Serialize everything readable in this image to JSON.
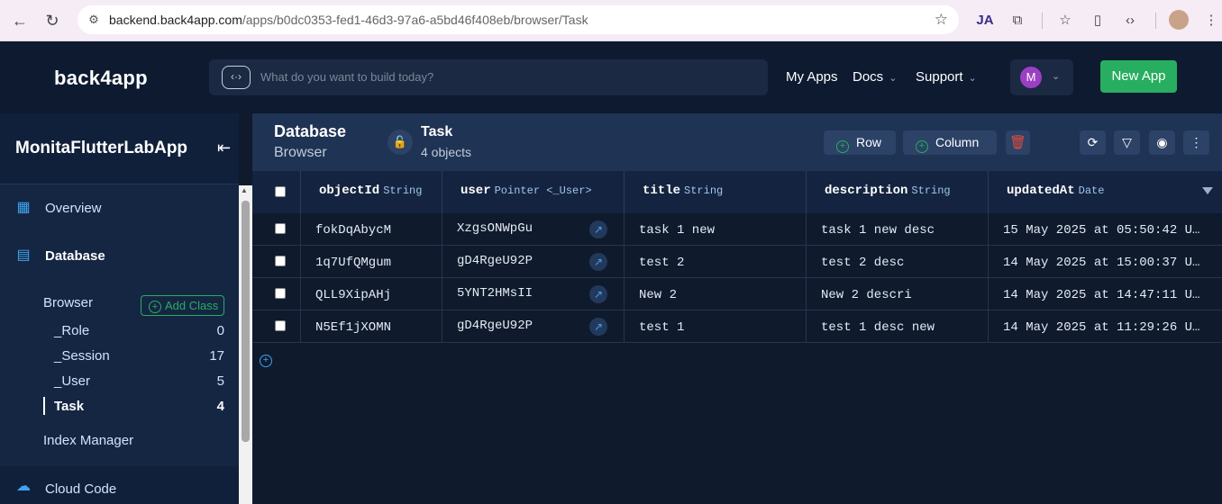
{
  "browser": {
    "url_host": "backend.back4app.com",
    "url_path": "/apps/b0dc0353-fed1-46d3-97a6-a5bd46f408eb/browser/Task"
  },
  "header": {
    "logo": "back4app",
    "search_placeholder": "What do you want to build today?",
    "nav": {
      "my_apps": "My Apps",
      "docs": "Docs",
      "support": "Support"
    },
    "avatar_initial": "M",
    "new_app": "New App"
  },
  "sidebar": {
    "app_name": "MonitaFlutterLabApp",
    "overview": "Overview",
    "database": "Database",
    "browser": "Browser",
    "add_class": "Add Class",
    "classes": [
      {
        "name": "_Role",
        "count": "0"
      },
      {
        "name": "_Session",
        "count": "17"
      },
      {
        "name": "_User",
        "count": "5"
      },
      {
        "name": "Task",
        "count": "4"
      }
    ],
    "index_manager": "Index Manager",
    "cloud_code": "Cloud Code"
  },
  "content_header": {
    "title": "Database",
    "subtitle": "Browser",
    "class_name": "Task",
    "object_count": "4 objects",
    "row_btn": "Row",
    "column_btn": "Column"
  },
  "table": {
    "columns": [
      {
        "name": "objectId",
        "type": "String"
      },
      {
        "name": "user",
        "type": "Pointer <_User>"
      },
      {
        "name": "title",
        "type": "String"
      },
      {
        "name": "description",
        "type": "String"
      },
      {
        "name": "updatedAt",
        "type": "Date"
      }
    ],
    "rows": [
      {
        "objectId": "fokDqAbycM",
        "user": "XzgsONWpGu",
        "title": "task 1 new",
        "description": "task 1 new desc",
        "updatedAt": "15 May 2025 at 05:50:42 U…"
      },
      {
        "objectId": "1q7UfQMgum",
        "user": "gD4RgeU92P",
        "title": "test 2",
        "description": "test 2 desc",
        "updatedAt": "14 May 2025 at 15:00:37 U…"
      },
      {
        "objectId": "QLL9XipAHj",
        "user": "5YNT2HMsII",
        "title": "New 2",
        "description": "New 2 descri",
        "updatedAt": "14 May 2025 at 14:47:11 U…"
      },
      {
        "objectId": "N5Ef1jXOMN",
        "user": "gD4RgeU92P",
        "title": "test 1",
        "description": "test 1 desc new",
        "updatedAt": "14 May 2025 at 11:29:26 U…"
      }
    ]
  }
}
